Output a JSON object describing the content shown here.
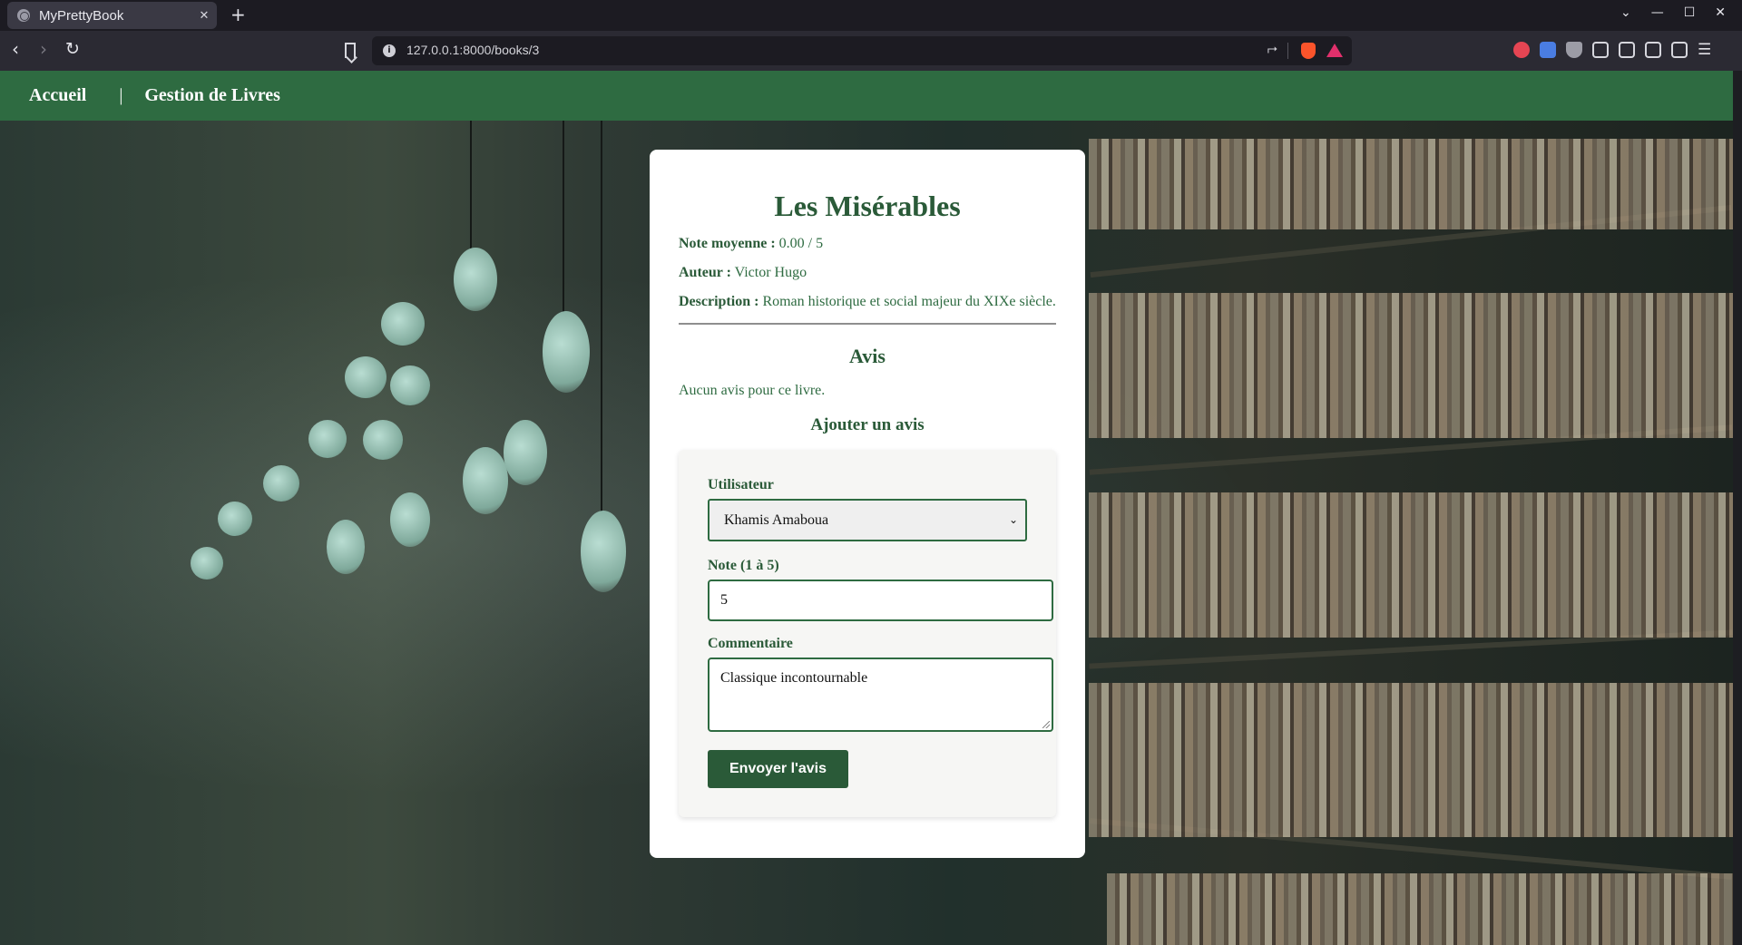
{
  "browser": {
    "tab_title": "MyPrettyBook",
    "tab_close": "✕",
    "new_tab": "+",
    "url": "127.0.0.1:8000/books/3",
    "controls": {
      "minimize": "—",
      "maximize": "☐",
      "close": "✕",
      "tabs_menu": "⌄"
    }
  },
  "navbar": {
    "home": "Accueil",
    "separator": "|",
    "books": "Gestion de Livres",
    "color": "#2e6b41"
  },
  "book": {
    "title": "Les Misérables",
    "rating_label": "Note moyenne :",
    "rating_value": "0.00 / 5",
    "author_label": "Auteur :",
    "author_value": "Victor Hugo",
    "description_label": "Description :",
    "description_value": "Roman historique et social majeur du XIXe siècle."
  },
  "reviews": {
    "heading": "Avis",
    "empty_message": "Aucun avis pour ce livre."
  },
  "review_form": {
    "heading": "Ajouter un avis",
    "user_label": "Utilisateur",
    "user_selected": "Khamis Amaboua",
    "rating_label": "Note (1 à 5)",
    "rating_value": "5",
    "comment_label": "Commentaire",
    "comment_value": "Classique incontournable",
    "submit_label": "Envoyer l'avis"
  }
}
